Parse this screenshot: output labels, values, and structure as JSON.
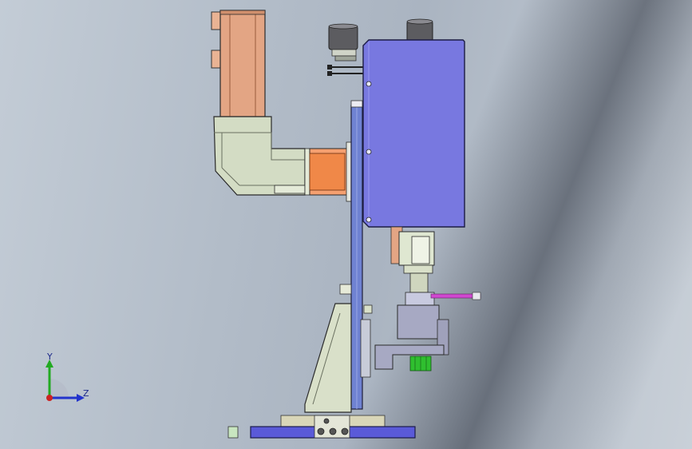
{
  "viewport": {
    "background_colors": [
      "#c3ccd6",
      "#aab4c1",
      "#c9d0d8"
    ]
  },
  "model": {
    "components": [
      {
        "name": "servo-motor",
        "color": "#e3a584"
      },
      {
        "name": "reducer-elbow",
        "color": "#d3dcc4"
      },
      {
        "name": "coupling-block",
        "color": "#f08848"
      },
      {
        "name": "main-column-plate",
        "color": "#6f82d2"
      },
      {
        "name": "cylinder-housing",
        "color": "#7878e0"
      },
      {
        "name": "top-cylinders",
        "color": "#5c5c60"
      },
      {
        "name": "slide-guide",
        "color": "#dfe7d1"
      },
      {
        "name": "gripper-head",
        "color": "#a7a9c3"
      },
      {
        "name": "support-bracket",
        "color": "#d9e0c9"
      },
      {
        "name": "base-plate",
        "color": "#5a5ad8"
      },
      {
        "name": "sensor-rod",
        "color": "#d048d0"
      },
      {
        "name": "green-fitting",
        "color": "#2fbf2f"
      }
    ]
  },
  "triad": {
    "y_label": "Y",
    "z_label": "Z",
    "y_color": "#22aa22",
    "z_color": "#2233cc",
    "x_color": "#cc2222"
  }
}
